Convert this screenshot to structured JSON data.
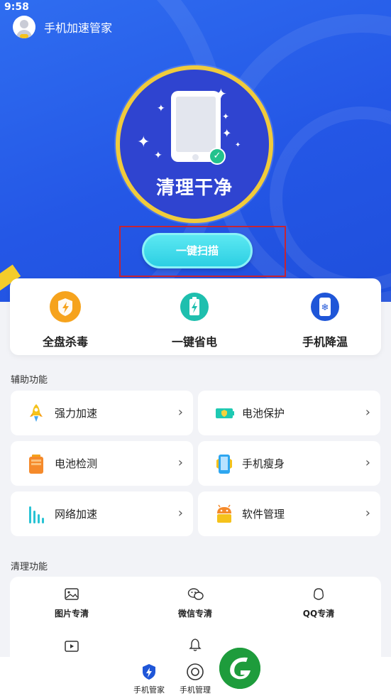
{
  "status_bar": {
    "time": "9:58"
  },
  "header": {
    "title": "手机加速管家"
  },
  "hero": {
    "status_text": "清理干净",
    "scan_button": "一键扫描"
  },
  "quick_actions": [
    {
      "label": "全盘杀毒",
      "icon": "shield-bolt-icon"
    },
    {
      "label": "一键省电",
      "icon": "battery-bolt-icon"
    },
    {
      "label": "手机降温",
      "icon": "phone-snowflake-icon"
    }
  ],
  "auxiliary": {
    "section_title": "辅助功能",
    "items": [
      {
        "label": "强力加速",
        "icon": "rocket-icon"
      },
      {
        "label": "电池保护",
        "icon": "battery-shield-icon"
      },
      {
        "label": "电池检测",
        "icon": "battery-check-icon"
      },
      {
        "label": "手机瘦身",
        "icon": "phone-slim-icon"
      },
      {
        "label": "网络加速",
        "icon": "signal-bars-icon"
      },
      {
        "label": "软件管理",
        "icon": "android-icon"
      }
    ]
  },
  "cleaning": {
    "section_title": "清理功能",
    "items": [
      {
        "label": "图片专清",
        "icon": "image-icon"
      },
      {
        "label": "微信专清",
        "icon": "wechat-icon"
      },
      {
        "label": "QQ专清",
        "icon": "qq-icon"
      },
      {
        "label": "",
        "icon": "video-icon"
      },
      {
        "label": "",
        "icon": "bell-icon"
      }
    ]
  },
  "bottom_nav": [
    {
      "label": "手机管家",
      "icon": "shield-bolt-nav-icon"
    },
    {
      "label": "手机管理",
      "icon": "circle-target-icon"
    }
  ],
  "colors": {
    "hero_blue": "#2457e6",
    "ring_gold": "#f0cb3c",
    "scan_cyan": "#2ccfe3",
    "highlight_red": "#c62433"
  }
}
